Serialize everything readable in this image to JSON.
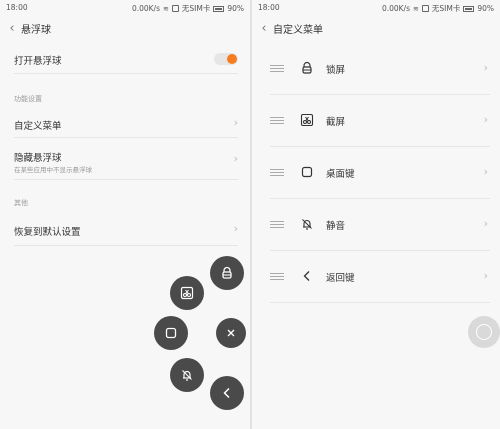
{
  "status_left": {
    "time": "18:00",
    "speed": "0.00K/s",
    "sim": "无SIM卡",
    "battery": "90%"
  },
  "status_right": {
    "time": "18:00",
    "speed": "0.00K/s",
    "sim": "无SIM卡",
    "battery": "90%"
  },
  "left": {
    "title": "悬浮球",
    "toggle_label": "打开悬浮球",
    "toggle_on": true,
    "section1": "功能设置",
    "custom_menu": "自定义菜单",
    "hide_title": "隐藏悬浮球",
    "hide_sub": "在某些应用中不显示悬浮球",
    "section2": "其他",
    "restore": "恢复到默认设置"
  },
  "fab_icons": [
    "lock-icon",
    "screenshot-icon",
    "home-square-icon",
    "close-icon",
    "mute-bell-icon",
    "back-arrow-icon"
  ],
  "right": {
    "title": "自定义菜单",
    "items": [
      {
        "label": "锁屏",
        "icon": "lock-icon"
      },
      {
        "label": "截屏",
        "icon": "screenshot-icon"
      },
      {
        "label": "桌面键",
        "icon": "home-square-icon"
      },
      {
        "label": "静音",
        "icon": "mute-bell-icon"
      },
      {
        "label": "返回键",
        "icon": "back-arrow-icon"
      }
    ]
  },
  "colors": {
    "accent": "#f57c1f",
    "fab": "#4a4a4a",
    "background": "#f7f7f7"
  }
}
